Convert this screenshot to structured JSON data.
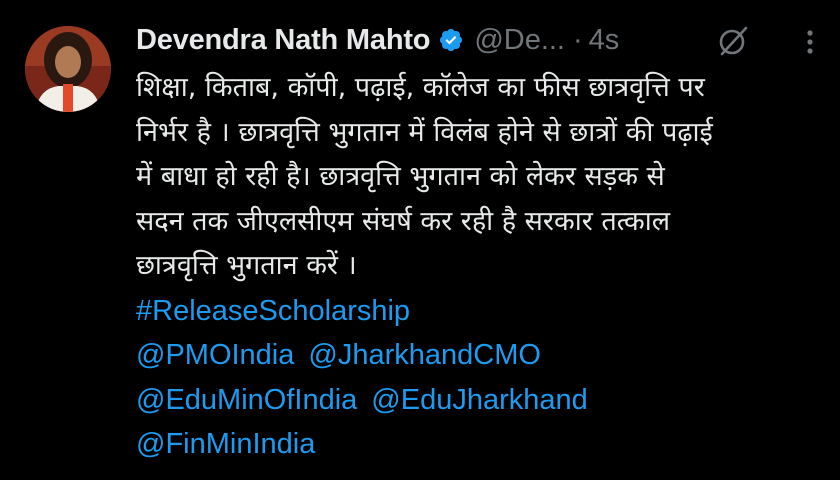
{
  "tweet": {
    "author": {
      "display_name": "Devendra Nath Mahto",
      "handle": "@De...",
      "verified_icon": "verified-badge-icon"
    },
    "separator": "·",
    "time": "4s",
    "actions": {
      "grok_icon": "grok-icon",
      "more_icon": "more-options-icon"
    },
    "text_lines": [
      "शिक्षा, किताब, कॉपी, पढ़ाई, कॉलेज का फीस छात्रवृत्ति पर",
      "निर्भर है  । छात्रवृत्ति भुगतान में विलंब होने से छात्रों की पढ़ाई",
      "में बाधा हो रही है।  छात्रवृत्ति भुगतान को लेकर सड़क से",
      "सदन तक जीएलसीएम संघर्ष कर रही है सरकार तत्काल",
      "छात्रवृत्ति भुगतान करें ।"
    ],
    "hashtag": "#ReleaseScholarship",
    "mentions": [
      "@PMOIndia",
      "@JharkhandCMO",
      "@EduMinOfIndia",
      "@EduJharkhand",
      "@FinMinIndia"
    ]
  },
  "colors": {
    "background": "#000000",
    "text": "#e7e9ea",
    "muted": "#71767b",
    "link": "#1d9bf0",
    "verified": "#1d9bf0"
  }
}
